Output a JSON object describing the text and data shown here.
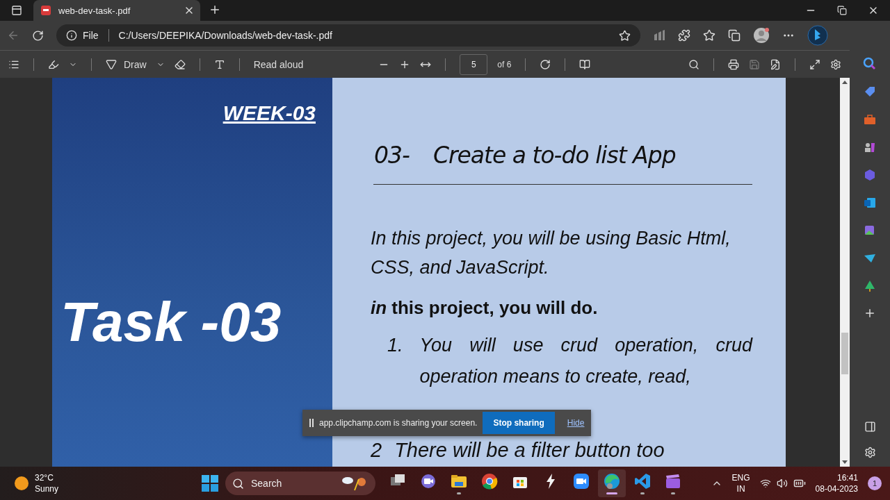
{
  "browser": {
    "tab": {
      "title": "web-dev-task-.pdf",
      "selected": true
    },
    "address": {
      "scheme": "File",
      "url": "C:/Users/DEEPIKA/Downloads/web-dev-task-.pdf"
    }
  },
  "pdf_toolbar": {
    "draw": "Draw",
    "read_aloud": "Read aloud",
    "page": "5",
    "page_count": "of 6"
  },
  "document": {
    "week": "WEEK-03",
    "task": "Task -03",
    "heading_number": "03-",
    "heading": "Create a to-do list App",
    "intro": "In this project, you will be using Basic Html, CSS, and JavaScript.",
    "lead": "*in* this project, you will do.",
    "items": [
      {
        "kind": "indented",
        "number": "1.",
        "text": "You will use crud operation, crud operation means to create, read,"
      },
      {
        "kind": "plain",
        "number": "2",
        "text": "There will be a filter button too"
      }
    ]
  },
  "share_bar": {
    "message": "app.clipchamp.com is sharing your screen.",
    "stop": "Stop sharing",
    "hide": "Hide"
  },
  "taskbar": {
    "weather": {
      "temp": "32°C",
      "condition": "Sunny"
    },
    "search": {
      "placeholder": "Search"
    },
    "apps": [
      {
        "kind": "taskview",
        "running": false,
        "selected": false
      },
      {
        "kind": "teams",
        "running": false,
        "selected": false
      },
      {
        "kind": "explorer",
        "running": true,
        "selected": false
      },
      {
        "kind": "chrome",
        "running": false,
        "selected": false
      },
      {
        "kind": "store",
        "running": false,
        "selected": false
      },
      {
        "kind": "bolt",
        "running": false,
        "selected": false
      },
      {
        "kind": "zoom",
        "running": false,
        "selected": false
      },
      {
        "kind": "edge",
        "running": true,
        "selected": true
      },
      {
        "kind": "vscode",
        "running": true,
        "selected": false
      },
      {
        "kind": "clipchamp",
        "running": true,
        "selected": false
      }
    ],
    "language": "ENG",
    "region": "IN",
    "time": "16:41",
    "date": "08-04-2023",
    "notifications": "1"
  }
}
